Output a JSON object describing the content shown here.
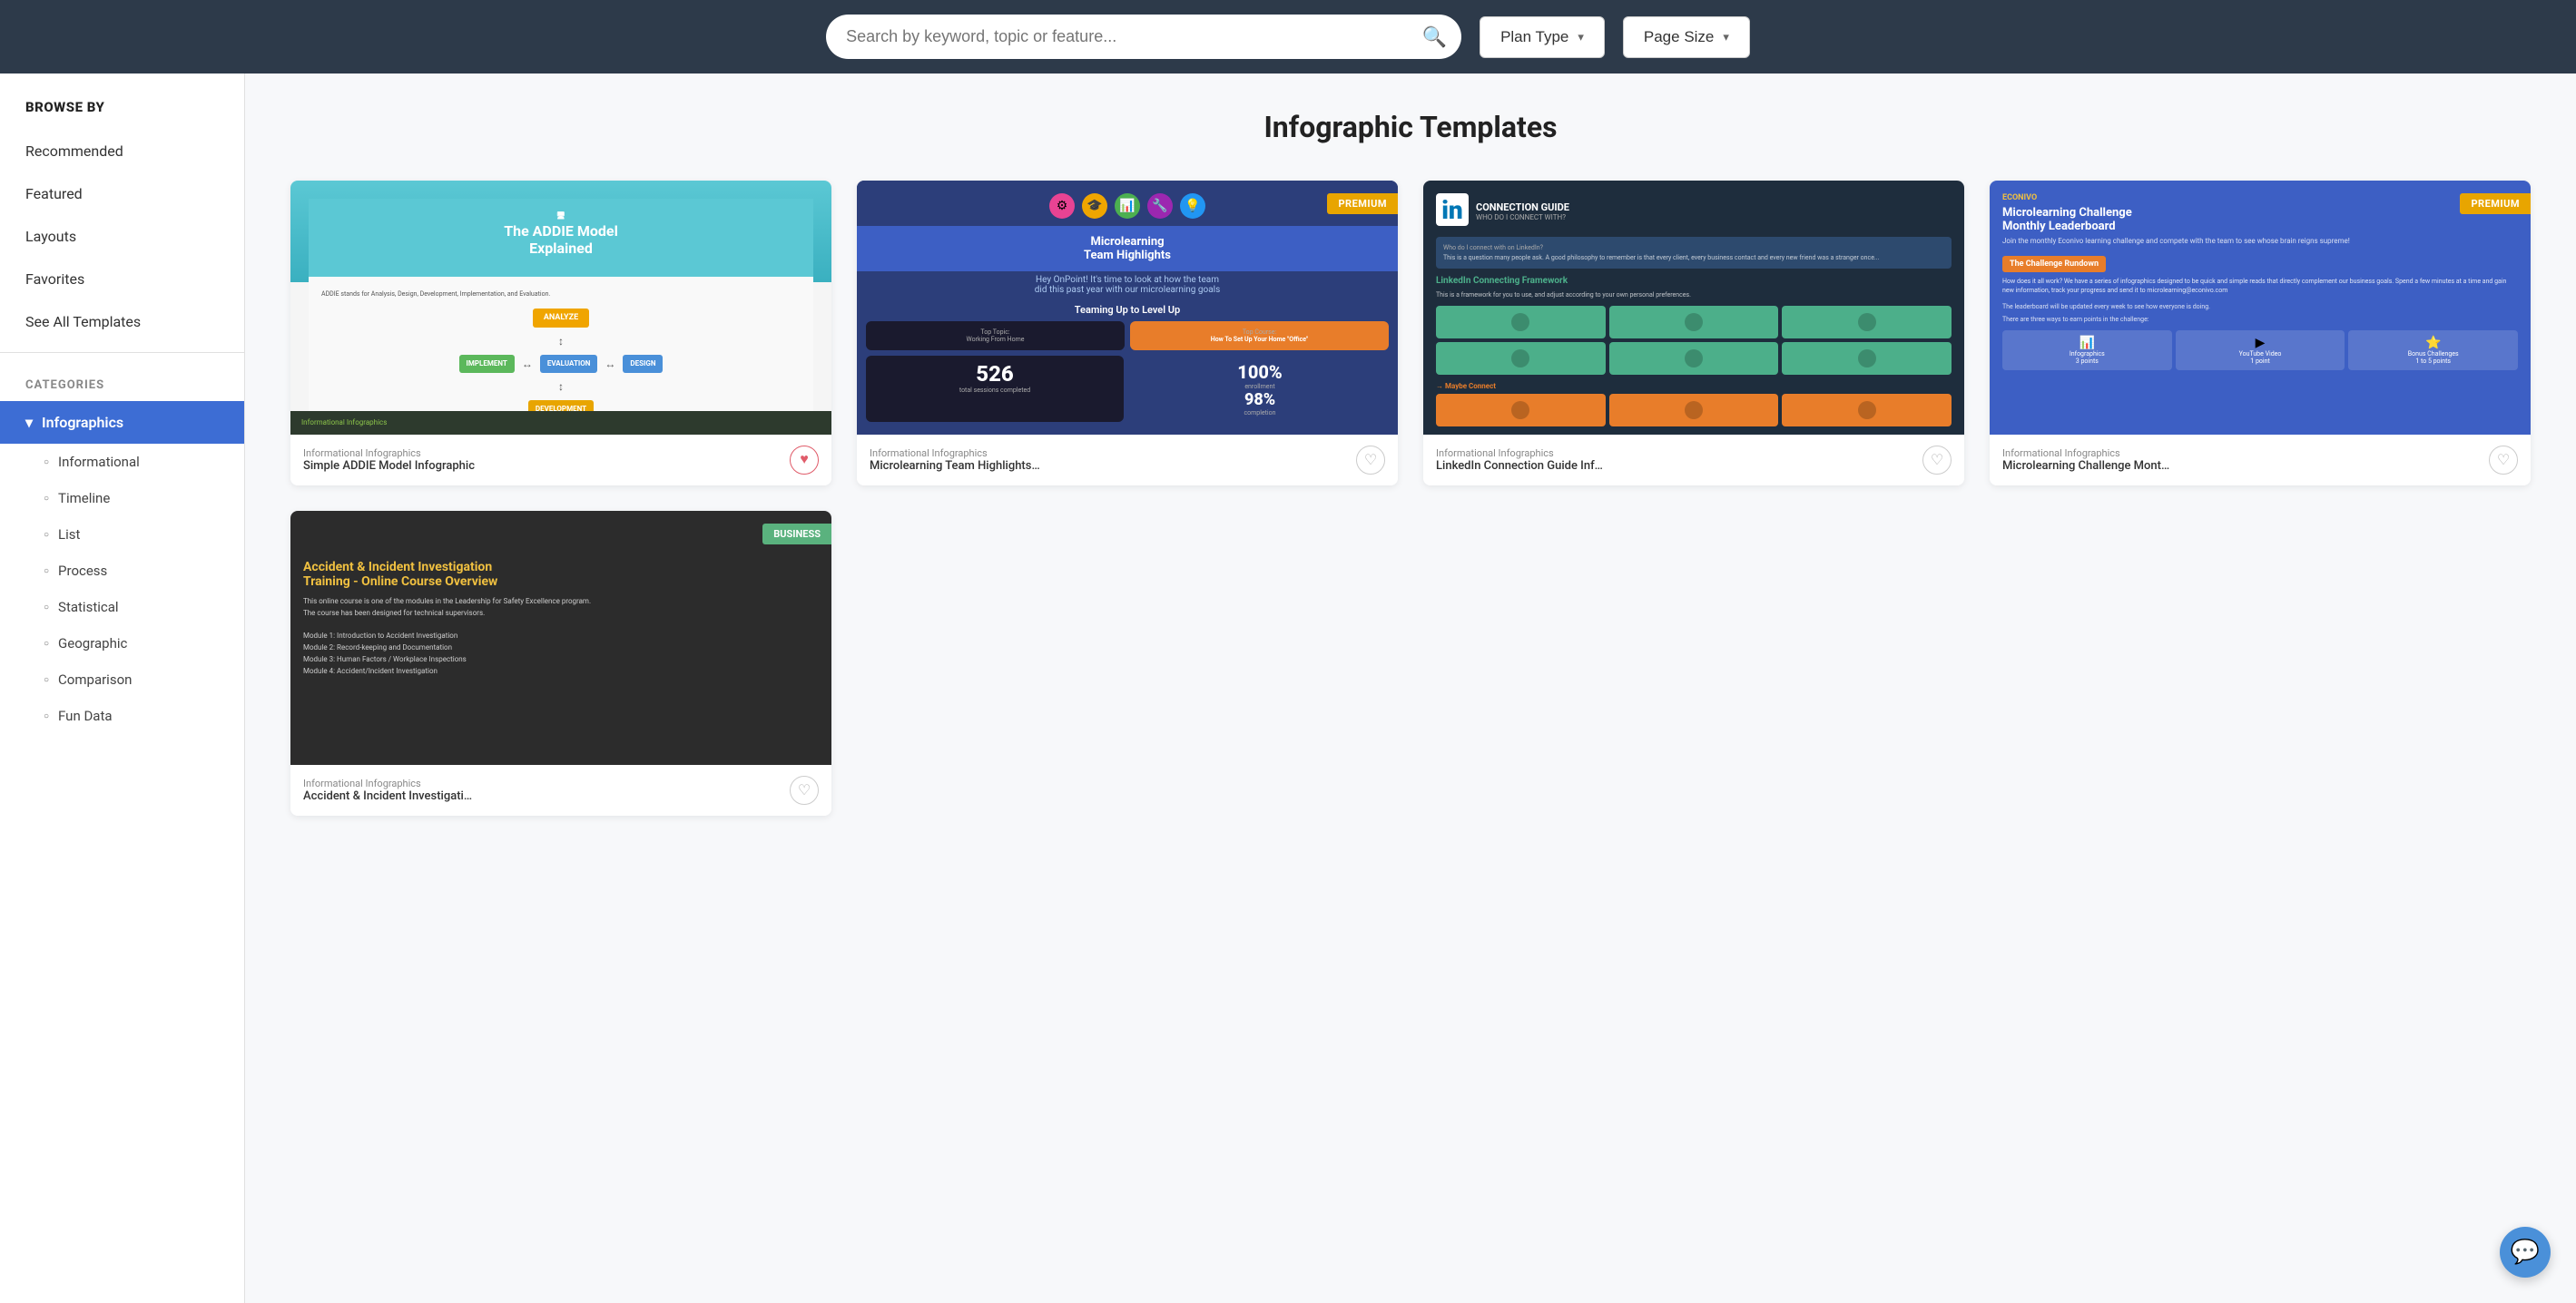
{
  "header": {
    "search_placeholder": "Search by keyword, topic or feature...",
    "plan_type_label": "Plan Type",
    "page_size_label": "Page Size"
  },
  "sidebar": {
    "browse_by_title": "BROWSE BY",
    "nav_items": [
      {
        "label": "Recommended",
        "id": "recommended"
      },
      {
        "label": "Featured",
        "id": "featured"
      },
      {
        "label": "Layouts",
        "id": "layouts"
      },
      {
        "label": "Favorites",
        "id": "favorites"
      },
      {
        "label": "See All Templates",
        "id": "see-all"
      }
    ],
    "categories_title": "CATEGORIES",
    "active_category": "Infographics",
    "sub_items": [
      {
        "label": "Informational",
        "id": "informational"
      },
      {
        "label": "Timeline",
        "id": "timeline"
      },
      {
        "label": "List",
        "id": "list"
      },
      {
        "label": "Process",
        "id": "process"
      },
      {
        "label": "Statistical",
        "id": "statistical"
      },
      {
        "label": "Geographic",
        "id": "geographic"
      },
      {
        "label": "Comparison",
        "id": "comparison"
      },
      {
        "label": "Fun Data",
        "id": "fun-data"
      }
    ]
  },
  "content": {
    "page_title": "Infographic Templates",
    "templates": [
      {
        "id": "addie",
        "category": "Informational Infographics",
        "name": "Simple ADDIE Model Infographic",
        "premium": false,
        "business": false,
        "favorited": true
      },
      {
        "id": "microlearning",
        "category": "Informational Infographics",
        "name": "Microlearning Team Highlights I...",
        "premium": true,
        "business": false,
        "favorited": false
      },
      {
        "id": "linkedin",
        "category": "Informational Infographics",
        "name": "LinkedIn Connection Guide Info...",
        "premium": false,
        "business": false,
        "favorited": false
      },
      {
        "id": "challenge",
        "category": "Informational Infographics",
        "name": "Microlearning Challenge Month...",
        "premium": true,
        "business": false,
        "favorited": false
      },
      {
        "id": "accident",
        "category": "Informational Infographics",
        "name": "Accident & Incident Investigation Training",
        "premium": false,
        "business": true,
        "favorited": false
      }
    ]
  },
  "icons": {
    "search": "🔍",
    "chevron_down": "▾",
    "heart_empty": "♡",
    "heart_filled": "♥",
    "chat": "💬",
    "chevron_expand": "›",
    "circle": "○"
  },
  "labels": {
    "premium": "PREMIUM",
    "business": "BUSINESS"
  }
}
